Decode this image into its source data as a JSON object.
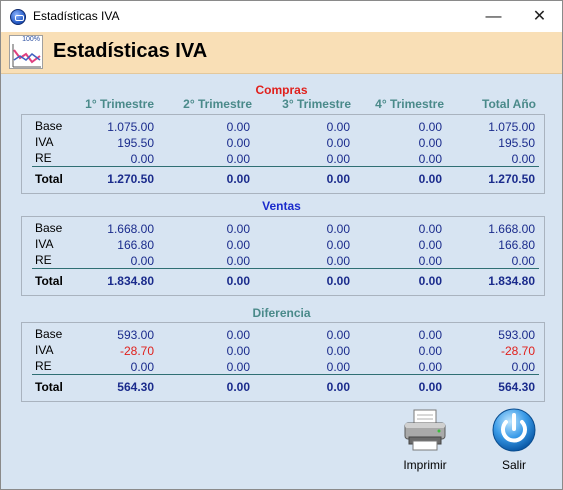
{
  "window": {
    "title": "Estadísticas IVA",
    "minimize": "—",
    "close": "✕"
  },
  "header": {
    "title": "Estadísticas IVA",
    "icon_text": "100%"
  },
  "columns": [
    "1° Trimestre",
    "2° Trimestre",
    "3° Trimestre",
    "4° Trimestre",
    "Total Año"
  ],
  "sections": [
    {
      "title": "Compras",
      "color": "#e0201c",
      "rows": [
        {
          "label": "Base",
          "values": [
            "1.075.00",
            "0.00",
            "0.00",
            "0.00",
            "1.075.00"
          ]
        },
        {
          "label": "IVA",
          "values": [
            "195.50",
            "0.00",
            "0.00",
            "0.00",
            "195.50"
          ]
        },
        {
          "label": "RE",
          "values": [
            "0.00",
            "0.00",
            "0.00",
            "0.00",
            "0.00"
          ]
        }
      ],
      "total": {
        "label": "Total",
        "values": [
          "1.270.50",
          "0.00",
          "0.00",
          "0.00",
          "1.270.50"
        ]
      }
    },
    {
      "title": "Ventas",
      "color": "#1a2bcc",
      "rows": [
        {
          "label": "Base",
          "values": [
            "1.668.00",
            "0.00",
            "0.00",
            "0.00",
            "1.668.00"
          ]
        },
        {
          "label": "IVA",
          "values": [
            "166.80",
            "0.00",
            "0.00",
            "0.00",
            "166.80"
          ]
        },
        {
          "label": "RE",
          "values": [
            "0.00",
            "0.00",
            "0.00",
            "0.00",
            "0.00"
          ]
        }
      ],
      "total": {
        "label": "Total",
        "values": [
          "1.834.80",
          "0.00",
          "0.00",
          "0.00",
          "1.834.80"
        ]
      }
    },
    {
      "title": "Diferencia",
      "color": "#4a8a8a",
      "rows": [
        {
          "label": "Base",
          "values": [
            "593.00",
            "0.00",
            "0.00",
            "0.00",
            "593.00"
          ]
        },
        {
          "label": "IVA",
          "values": [
            "-28.70",
            "0.00",
            "0.00",
            "0.00",
            "-28.70"
          ]
        },
        {
          "label": "RE",
          "values": [
            "0.00",
            "0.00",
            "0.00",
            "0.00",
            "0.00"
          ]
        }
      ],
      "total": {
        "label": "Total",
        "values": [
          "564.30",
          "0.00",
          "0.00",
          "0.00",
          "564.30"
        ]
      }
    }
  ],
  "buttons": {
    "print": "Imprimir",
    "exit": "Salir"
  },
  "colors": {
    "header_bg": "#f9dfb6",
    "panel_bg": "#d7e4f2",
    "number": "#1a2b8c",
    "negative": "#e0201c",
    "column_header": "#4a8a8a"
  }
}
